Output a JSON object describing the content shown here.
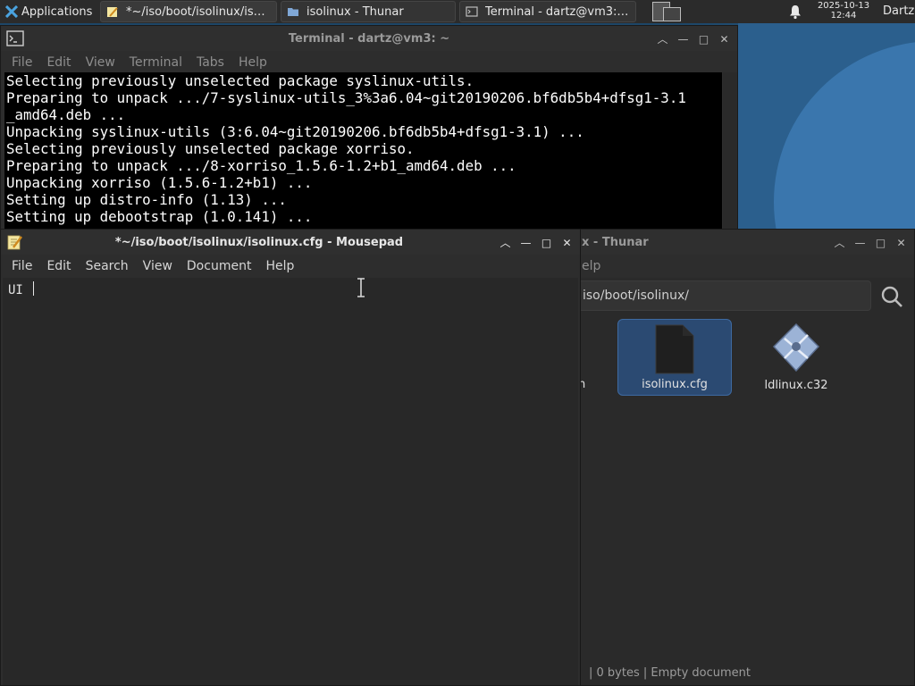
{
  "panel": {
    "applications_label": "Applications",
    "tasks": [
      {
        "label": "*~/iso/boot/isolinux/isol...",
        "icon": "text-editor-icon"
      },
      {
        "label": "isolinux - Thunar",
        "icon": "folder-icon"
      },
      {
        "label": "Terminal - dartz@vm3: ~",
        "icon": "terminal-icon"
      }
    ],
    "clock_date": "2025-10-13",
    "clock_time": "12:44",
    "user": "Dartz"
  },
  "terminal": {
    "title": "Terminal - dartz@vm3: ~",
    "menu": [
      "File",
      "Edit",
      "View",
      "Terminal",
      "Tabs",
      "Help"
    ],
    "lines": [
      "Selecting previously unselected package syslinux-utils.",
      "Preparing to unpack .../7-syslinux-utils_3%3a6.04~git20190206.bf6db5b4+dfsg1-3.1",
      "_amd64.deb ...",
      "Unpacking syslinux-utils (3:6.04~git20190206.bf6db5b4+dfsg1-3.1) ...",
      "Selecting previously unselected package xorriso.",
      "Preparing to unpack .../8-xorriso_1.5.6-1.2+b1_amd64.deb ...",
      "Unpacking xorriso (1.5.6-1.2+b1) ...",
      "Setting up distro-info (1.13) ...",
      "Setting up debootstrap (1.0.141) ..."
    ]
  },
  "thunar": {
    "title": "x - Thunar",
    "menu_partial": "elp",
    "path": "iso/boot/isolinux/",
    "files": [
      {
        "name": "isolinux.cfg",
        "icon": "document-icon",
        "selected": true
      },
      {
        "name": "ldlinux.c32",
        "icon": "binary-file-icon",
        "selected": false
      }
    ],
    "partial_file_label": "n",
    "status": "|  0 bytes  |  Empty document"
  },
  "mousepad": {
    "title": "*~/iso/boot/isolinux/isolinux.cfg - Mousepad",
    "menu": [
      "File",
      "Edit",
      "Search",
      "View",
      "Document",
      "Help"
    ],
    "content": "UI "
  },
  "colors": {
    "selection": "#2b4a72",
    "terminal_bg": "#000000",
    "window_bg": "#2d2d2d"
  }
}
